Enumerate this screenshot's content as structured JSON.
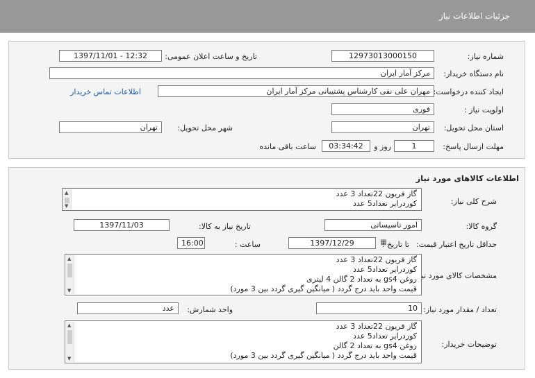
{
  "header": {
    "title": "جزئیات اطلاعات نیاز"
  },
  "info": {
    "need_number_label": "شماره نیاز:",
    "need_number": "12973013000150",
    "announce_label": "تاریخ و ساعت اعلان عمومی:",
    "announce_value": "1397/11/01 - 12:32",
    "buyer_org_label": "نام دستگاه خریدار:",
    "buyer_org": "مرکز آمار ایران",
    "creator_label": "ایجاد کننده درخواست:",
    "creator": "مهران  علی نقی کارشناس پشتیبانی مرکز آمار ایران",
    "contact_link": "اطلاعات تماس خریدار",
    "priority_label": "اولویت نیاز :",
    "priority": "فوری",
    "province_label": "استان محل تحویل:",
    "province": "تهران",
    "city_label": "شهر محل تحویل:",
    "city": "تهران",
    "deadline_label": "مهلت ارسال پاسخ:",
    "days": "1",
    "days_label": "روز و",
    "time_left": "03:34:42",
    "remaining_label": "ساعت باقی مانده"
  },
  "goods": {
    "section_title": "اطلاعات کالاهای مورد نیاز",
    "general_desc_label": "شرح کلی نیاز:",
    "general_desc": [
      "گاز فریون 22تعداد 3 عدد",
      "کوردرایر تعداد5 عدد"
    ],
    "group_label": "گروه کالا:",
    "group": "امور تاسیساتی",
    "need_date_label": "تاریخ نیاز به کالا:",
    "need_date": "1397/11/03",
    "validity_label": "حداقل تاریخ اعتبار قیمت:",
    "until_date_label": "تا تاریخ :",
    "until_date": "1397/12/29",
    "time_label": "ساعت :",
    "time": "16:00",
    "specs_label": "مشخصات کالای مورد نیاز:",
    "specs": [
      "گاز فریون 22تعداد 3 عدد",
      "کوردرایر تعداد5 عدد",
      "روغن gs4 به تعداد 2 گالن 4 لیتری",
      "قیمت واحد باید درج گردد ( میانگین گیری گردد بین 3 مورد)"
    ],
    "qty_label": "تعداد / مقدار مورد نیاز:",
    "qty": "10",
    "unit_label": "واحد شمارش:",
    "unit": "عدد",
    "buyer_notes_label": "توضیحات خریدار:",
    "buyer_notes": [
      "گاز فریون 22تعداد 3 عدد",
      "کوردرایر تعداد5 عدد",
      "روغن gs4 به تعداد 2 گالن",
      "قیمت واحد باید درج گردد ( میانگین گیری گردد بین 3 مورد)"
    ]
  }
}
